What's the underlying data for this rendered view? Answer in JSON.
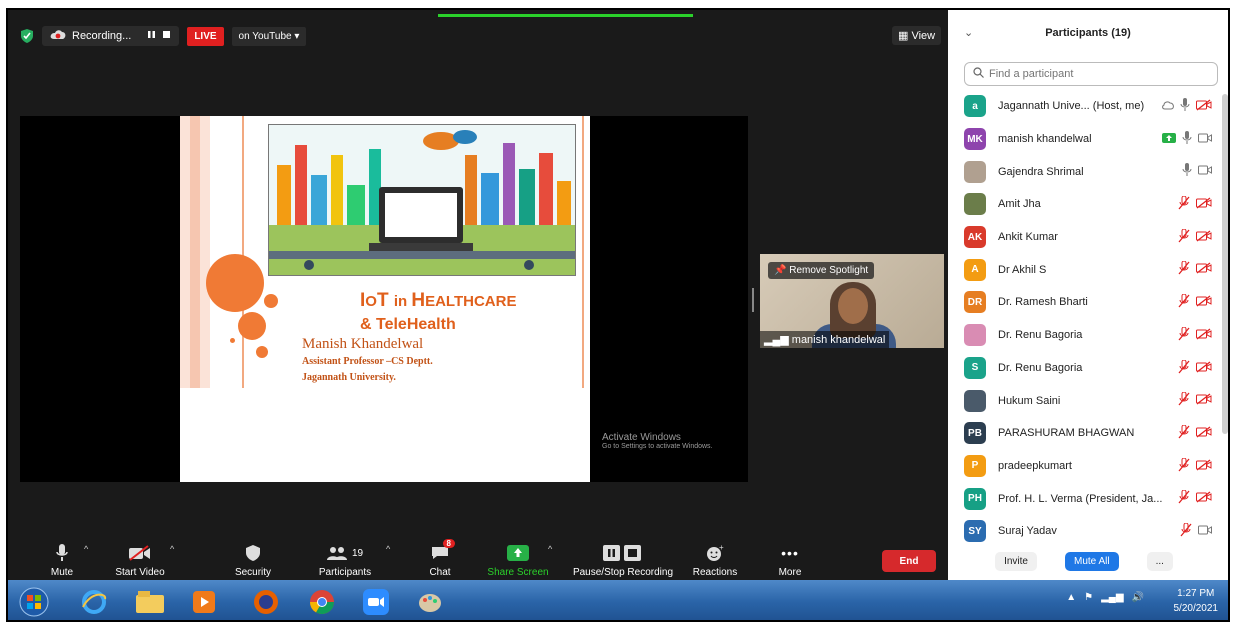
{
  "recording": {
    "label": "Recording..."
  },
  "live": {
    "badge": "LIVE",
    "destination": "on YouTube ▾"
  },
  "view": {
    "label": "View"
  },
  "slide": {
    "title_big1": "I",
    "title_small1": "O",
    "title_big2": "T ",
    "title_word_in": "in ",
    "title_big3": "H",
    "title_small3": "EALTHCARE",
    "subtitle": "& TeleHealth",
    "author": "Manish Khandelwal",
    "role": "Assistant Professor –CS Deptt.",
    "university": "Jagannath University."
  },
  "watermark": {
    "line1": "Activate Windows",
    "line2": "Go to Settings to activate Windows."
  },
  "camera": {
    "spotlight": "Remove Spotlight",
    "name": "manish khandelwal"
  },
  "toolbar": {
    "mute": "Mute",
    "start_video": "Start Video",
    "security": "Security",
    "participants": "Participants",
    "participants_count": "19",
    "chat": "Chat",
    "chat_badge": "8",
    "share_screen": "Share Screen",
    "pause_recording": "Pause/Stop Recording",
    "reactions": "Reactions",
    "more": "More",
    "end": "End"
  },
  "panel": {
    "title": "Participants (19)",
    "search_placeholder": "Find a participant",
    "invite": "Invite",
    "mute_all": "Mute All",
    "more": "...",
    "participants": [
      {
        "initials": "a",
        "name": "Jagannath Unive...  (Host, me)",
        "color": "#1aa38a",
        "mic": "on",
        "video": "off",
        "extra": "cloud"
      },
      {
        "initials": "MK",
        "name": "manish khandelwal",
        "color": "#8e44ad",
        "mic": "on",
        "video": "on",
        "extra": "share"
      },
      {
        "initials": "",
        "name": "Gajendra Shrimal",
        "color": "#b0a090",
        "mic": "on",
        "video": "on",
        "extra": ""
      },
      {
        "initials": "",
        "name": "Amit Jha",
        "color": "#6b7d4a",
        "mic": "off",
        "video": "off",
        "extra": ""
      },
      {
        "initials": "AK",
        "name": "Ankit Kumar",
        "color": "#d93a2b",
        "mic": "off",
        "video": "off",
        "extra": ""
      },
      {
        "initials": "A",
        "name": "Dr Akhil S",
        "color": "#f39c12",
        "mic": "off",
        "video": "off",
        "extra": ""
      },
      {
        "initials": "DR",
        "name": "Dr. Ramesh Bharti",
        "color": "#e67e22",
        "mic": "off",
        "video": "off",
        "extra": ""
      },
      {
        "initials": "",
        "name": "Dr. Renu Bagoria",
        "color": "#d98cb3",
        "mic": "off",
        "video": "off",
        "extra": ""
      },
      {
        "initials": "S",
        "name": "Dr. Renu Bagoria",
        "color": "#1aa38a",
        "mic": "off",
        "video": "off",
        "extra": ""
      },
      {
        "initials": "",
        "name": "Hukum Saini",
        "color": "#4a5a6a",
        "mic": "off",
        "video": "off",
        "extra": ""
      },
      {
        "initials": "PB",
        "name": "PARASHURAM BHAGWAN",
        "color": "#2c3e50",
        "mic": "off",
        "video": "off",
        "extra": ""
      },
      {
        "initials": "P",
        "name": "pradeepkumart",
        "color": "#f39c12",
        "mic": "off",
        "video": "off",
        "extra": ""
      },
      {
        "initials": "PH",
        "name": "Prof. H. L. Verma (President, Ja...",
        "color": "#16a085",
        "mic": "off",
        "video": "off",
        "extra": ""
      },
      {
        "initials": "SY",
        "name": "Suraj Yadav",
        "color": "#2b6cb0",
        "mic": "off",
        "video": "on",
        "extra": ""
      }
    ]
  },
  "clock": {
    "time": "1:27 PM",
    "date": "5/20/2021"
  }
}
